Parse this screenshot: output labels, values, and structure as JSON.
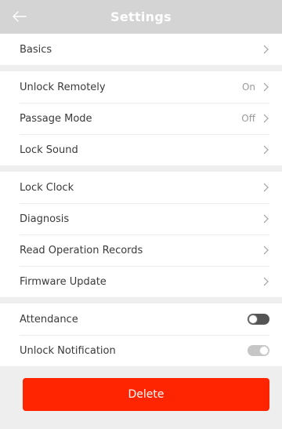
{
  "header": {
    "title": "Settings",
    "back_icon": "back-arrow-icon"
  },
  "groups": {
    "basics": {
      "label": "Basics"
    },
    "access": {
      "unlock_remotely": {
        "label": "Unlock Remotely",
        "value": "On"
      },
      "passage_mode": {
        "label": "Passage Mode",
        "value": "Off"
      },
      "lock_sound": {
        "label": "Lock Sound"
      }
    },
    "maintenance": {
      "lock_clock": {
        "label": "Lock Clock"
      },
      "diagnosis": {
        "label": "Diagnosis"
      },
      "read_operation_records": {
        "label": "Read Operation Records"
      },
      "firmware_update": {
        "label": "Firmware Update"
      }
    },
    "toggles": {
      "attendance": {
        "label": "Attendance",
        "enabled": false
      },
      "unlock_notification": {
        "label": "Unlock Notification",
        "enabled": true
      }
    }
  },
  "footer": {
    "delete_label": "Delete",
    "delete_color": "#ff2500"
  },
  "colors": {
    "header_bg": "#d4d4d4",
    "page_bg": "#eeeeee",
    "chevron": "#a0a0a0"
  }
}
